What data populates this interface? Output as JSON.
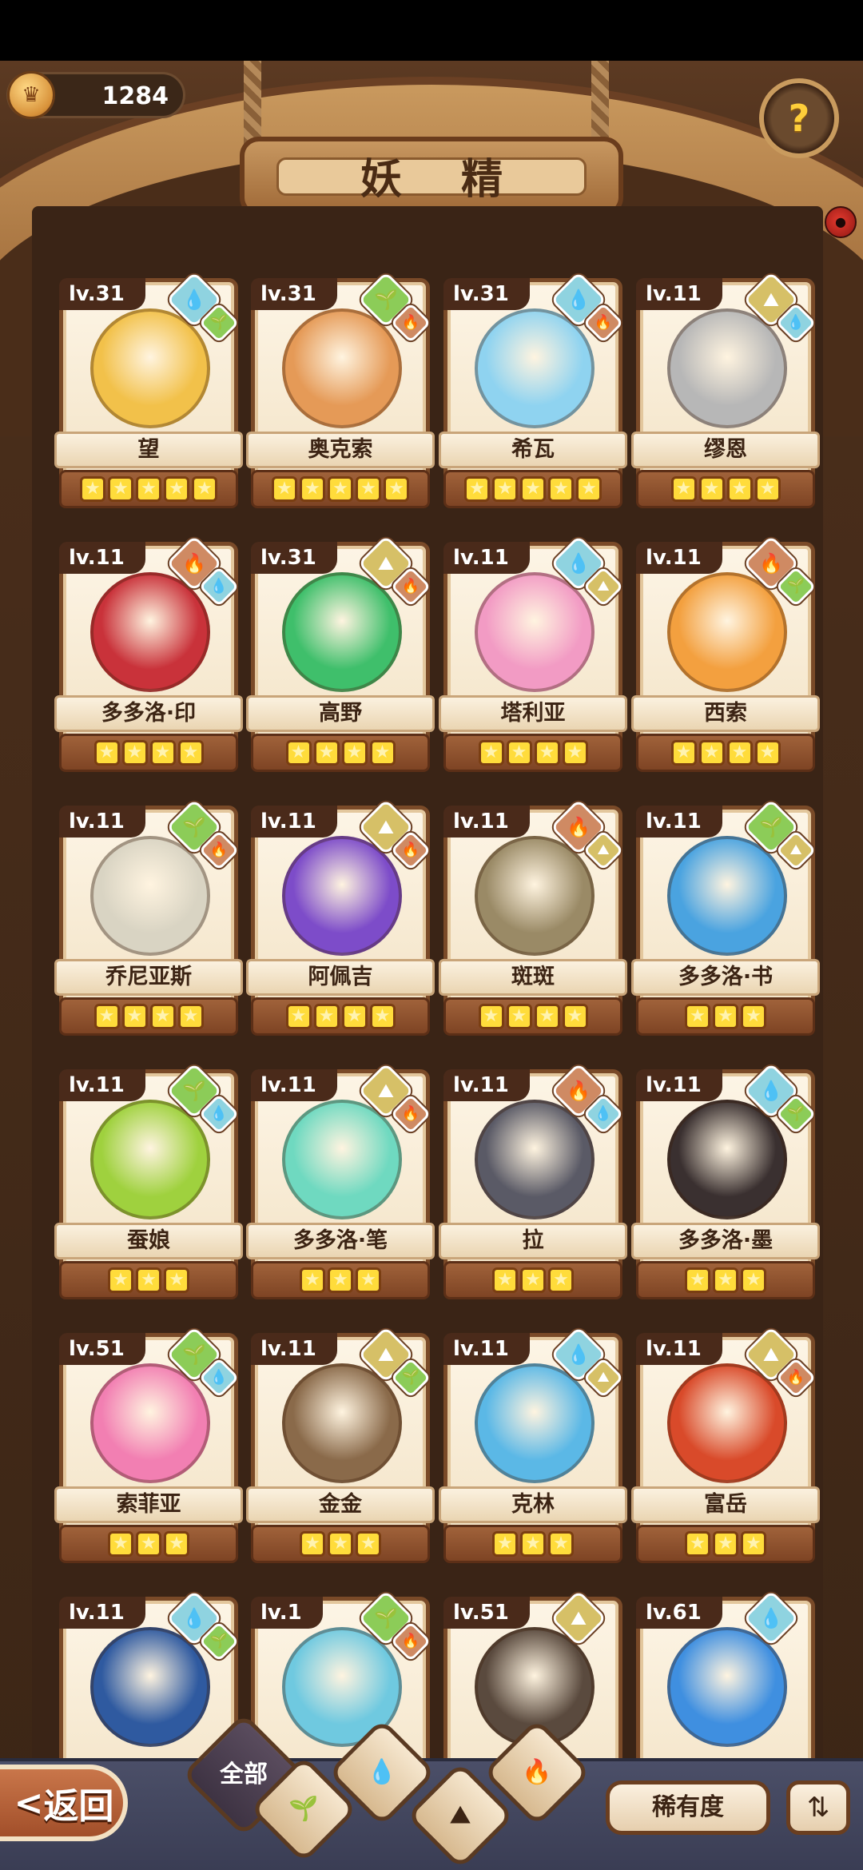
{
  "header": {
    "currency_value": "1284",
    "title": "妖 精",
    "help_symbol": "?"
  },
  "fairies": [
    {
      "level": "lv.31",
      "name": "望",
      "stars": 5,
      "color": "#f2c14a",
      "elements": [
        "water",
        "leaf"
      ]
    },
    {
      "level": "lv.31",
      "name": "奥克索",
      "stars": 5,
      "color": "#e59a57",
      "elements": [
        "leaf",
        "fire"
      ]
    },
    {
      "level": "lv.31",
      "name": "希瓦",
      "stars": 5,
      "color": "#8fd3f0",
      "elements": [
        "water",
        "fire"
      ]
    },
    {
      "level": "lv.11",
      "name": "缪恩",
      "stars": 4,
      "color": "#b7b7b7",
      "elements": [
        "earth",
        "water"
      ]
    },
    {
      "level": "lv.11",
      "name": "多多洛·印",
      "stars": 4,
      "color": "#c9323a",
      "elements": [
        "fire",
        "water"
      ]
    },
    {
      "level": "lv.31",
      "name": "高野",
      "stars": 4,
      "color": "#3fbf6b",
      "elements": [
        "earth",
        "fire"
      ]
    },
    {
      "level": "lv.11",
      "name": "塔利亚",
      "stars": 4,
      "color": "#f29bc4",
      "elements": [
        "water",
        "earth"
      ]
    },
    {
      "level": "lv.11",
      "name": "西索",
      "stars": 4,
      "color": "#f3a03f",
      "elements": [
        "fire",
        "leaf"
      ]
    },
    {
      "level": "lv.11",
      "name": "乔尼亚斯",
      "stars": 4,
      "color": "#d9d4c3",
      "elements": [
        "leaf",
        "fire"
      ]
    },
    {
      "level": "lv.11",
      "name": "阿佩吉",
      "stars": 4,
      "color": "#7d4cc9",
      "elements": [
        "earth",
        "fire"
      ]
    },
    {
      "level": "lv.11",
      "name": "斑斑",
      "stars": 4,
      "color": "#9a8a66",
      "elements": [
        "fire",
        "earth"
      ]
    },
    {
      "level": "lv.11",
      "name": "多多洛·书",
      "stars": 3,
      "color": "#4aa3e0",
      "elements": [
        "leaf",
        "earth"
      ]
    },
    {
      "level": "lv.11",
      "name": "蚕娘",
      "stars": 3,
      "color": "#9fd13e",
      "elements": [
        "leaf",
        "water"
      ]
    },
    {
      "level": "lv.11",
      "name": "多多洛·笔",
      "stars": 3,
      "color": "#6fd9c0",
      "elements": [
        "earth",
        "fire"
      ]
    },
    {
      "level": "lv.11",
      "name": "拉",
      "stars": 3,
      "color": "#5a5a66",
      "elements": [
        "fire",
        "water"
      ]
    },
    {
      "level": "lv.11",
      "name": "多多洛·墨",
      "stars": 3,
      "color": "#3a3030",
      "elements": [
        "water",
        "leaf"
      ]
    },
    {
      "level": "lv.51",
      "name": "索菲亚",
      "stars": 3,
      "color": "#f27fb2",
      "elements": [
        "leaf",
        "water"
      ]
    },
    {
      "level": "lv.11",
      "name": "金金",
      "stars": 3,
      "color": "#8a6a4a",
      "elements": [
        "earth",
        "leaf"
      ]
    },
    {
      "level": "lv.11",
      "name": "克林",
      "stars": 3,
      "color": "#5bb8e6",
      "elements": [
        "water",
        "earth"
      ]
    },
    {
      "level": "lv.11",
      "name": "富岳",
      "stars": 3,
      "color": "#d94a2a",
      "elements": [
        "earth",
        "fire"
      ]
    },
    {
      "level": "lv.11",
      "name": "",
      "stars": 0,
      "color": "#2f5aa0",
      "elements": [
        "water",
        "leaf"
      ]
    },
    {
      "level": "lv.1",
      "name": "",
      "stars": 0,
      "color": "#6fc9e0",
      "elements": [
        "leaf",
        "fire"
      ]
    },
    {
      "level": "lv.51",
      "name": "",
      "stars": 0,
      "color": "#5a4a3e",
      "elements": [
        "earth"
      ]
    },
    {
      "level": "lv.61",
      "name": "",
      "stars": 0,
      "color": "#3f8fe0",
      "elements": [
        "water"
      ]
    }
  ],
  "element_icons": {
    "water": "💧",
    "leaf": "🌱",
    "earth": "⛰",
    "fire": "🔥"
  },
  "bottom": {
    "back_label": "返回",
    "back_arrow": "<",
    "filter_all": "全部",
    "filter_leaf_icon": "🌱",
    "filter_water_icon": "💧",
    "filter_earth_icon": "⛰",
    "filter_fire_icon": "🔥",
    "rarity_label": "稀有度",
    "sort_icon": "⇅"
  }
}
